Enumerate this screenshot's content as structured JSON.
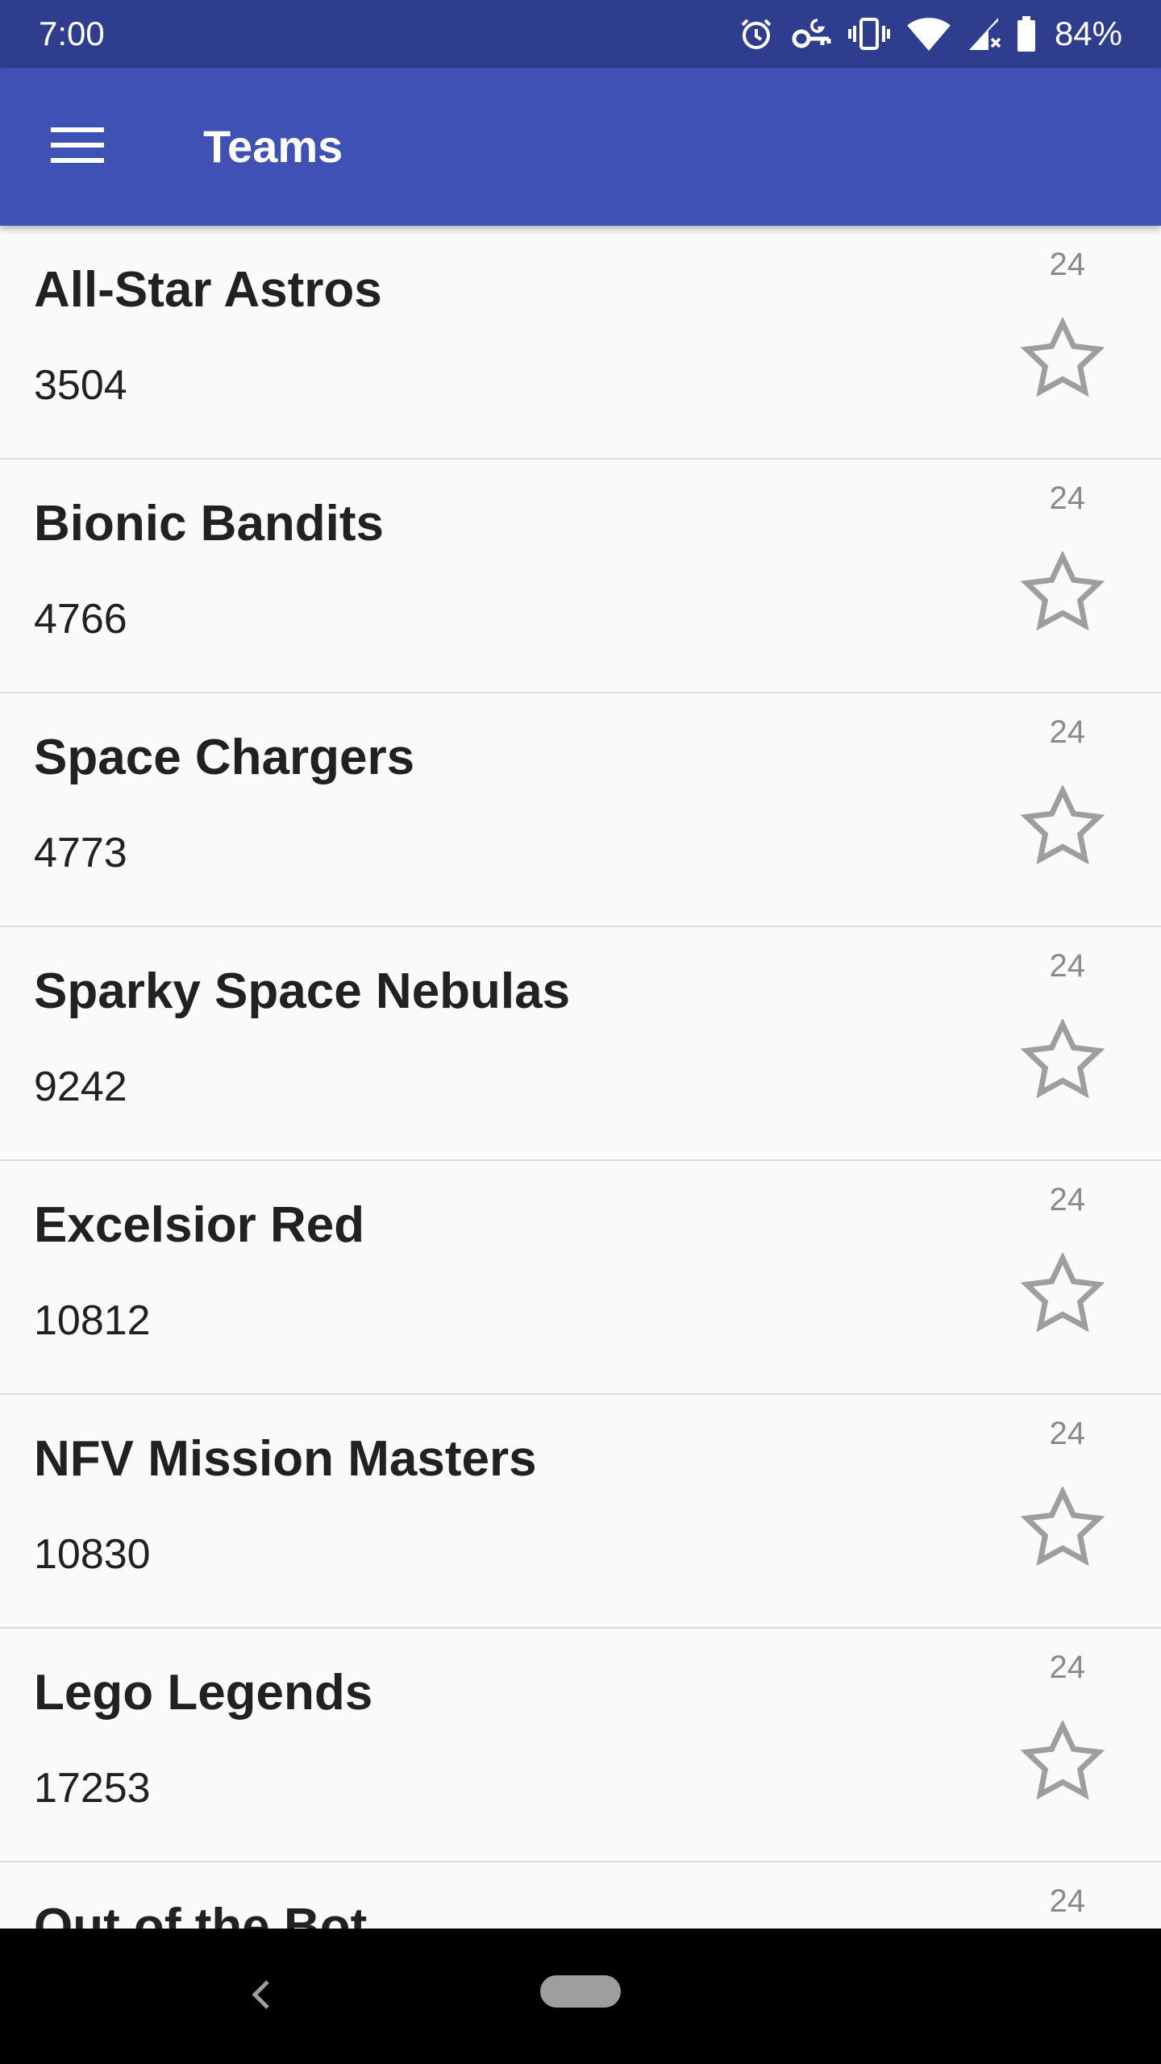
{
  "status_bar": {
    "time": "7:00",
    "battery": "84%",
    "icons": [
      "alarm-icon",
      "vpn-key-icon",
      "vibrate-icon",
      "wifi-icon",
      "cell-signal-icon",
      "battery-icon"
    ]
  },
  "app_bar": {
    "title": "Teams",
    "menu_icon": "menu-icon",
    "color": "#3f51b5"
  },
  "teams": [
    {
      "name": "All-Star Astros",
      "number": "3504",
      "count": "24",
      "starred": false
    },
    {
      "name": "Bionic Bandits",
      "number": "4766",
      "count": "24",
      "starred": false
    },
    {
      "name": "Space Chargers",
      "number": "4773",
      "count": "24",
      "starred": false
    },
    {
      "name": "Sparky Space Nebulas",
      "number": "9242",
      "count": "24",
      "starred": false
    },
    {
      "name": "Excelsior Red",
      "number": "10812",
      "count": "24",
      "starred": false
    },
    {
      "name": "NFV Mission Masters",
      "number": "10830",
      "count": "24",
      "starred": false
    },
    {
      "name": "Lego Legends",
      "number": "17253",
      "count": "24",
      "starred": false
    },
    {
      "name": "Out of the Bot",
      "number": "",
      "count": "24",
      "starred": false
    }
  ],
  "nav_bar": {
    "back_icon": "back-icon",
    "home_icon": "home-pill-icon"
  }
}
